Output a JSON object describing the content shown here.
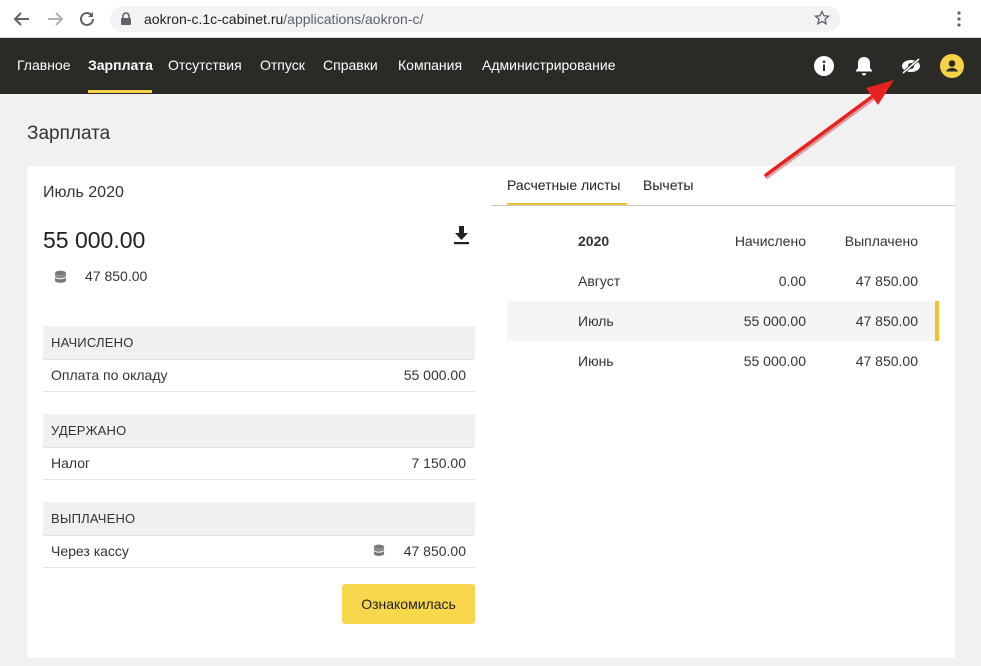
{
  "browser": {
    "url_host": "aokron-c.1c-cabinet.ru",
    "url_path": "/applications/aokron-c/"
  },
  "nav": {
    "items": [
      "Главное",
      "Зарплата",
      "Отсутствия",
      "Отпуск",
      "Справки",
      "Компания",
      "Администрирование"
    ],
    "active": "Зарплата"
  },
  "header_icons": [
    "info-icon",
    "bell-icon",
    "visibility-off-icon",
    "avatar-icon"
  ],
  "page": {
    "title": "Зарплата"
  },
  "payslip": {
    "period": "Июль 2020",
    "total": "55 000.00",
    "paid_amount": "47 850.00",
    "sections": [
      {
        "title": "НАЧИСЛЕНО",
        "rows": [
          {
            "label": "Оплата по окладу",
            "value": "55 000.00"
          }
        ]
      },
      {
        "title": "УДЕРЖАНО",
        "rows": [
          {
            "label": "Налог",
            "value": "7 150.00"
          }
        ]
      },
      {
        "title": "ВЫПЛАЧЕНО",
        "rows": [
          {
            "label": "Через кассу",
            "value": "47 850.00"
          }
        ]
      }
    ],
    "ack_button": "Ознакомилась"
  },
  "tabs": [
    "Расчетные листы",
    "Вычеты"
  ],
  "table": {
    "headers": {
      "year": "2020",
      "accrued": "Начислено",
      "paid": "Выплачено"
    },
    "rows": [
      {
        "month": "Август",
        "accrued": "0.00",
        "paid": "47 850.00"
      },
      {
        "month": "Июль",
        "accrued": "55 000.00",
        "paid": "47 850.00"
      },
      {
        "month": "Июнь",
        "accrued": "55 000.00",
        "paid": "47 850.00"
      }
    ],
    "selected_month": "Июль"
  },
  "colors": {
    "header_bg": "#2a2a27",
    "accent": "#f7d84c",
    "annotation_arrow": "#e8231f"
  }
}
